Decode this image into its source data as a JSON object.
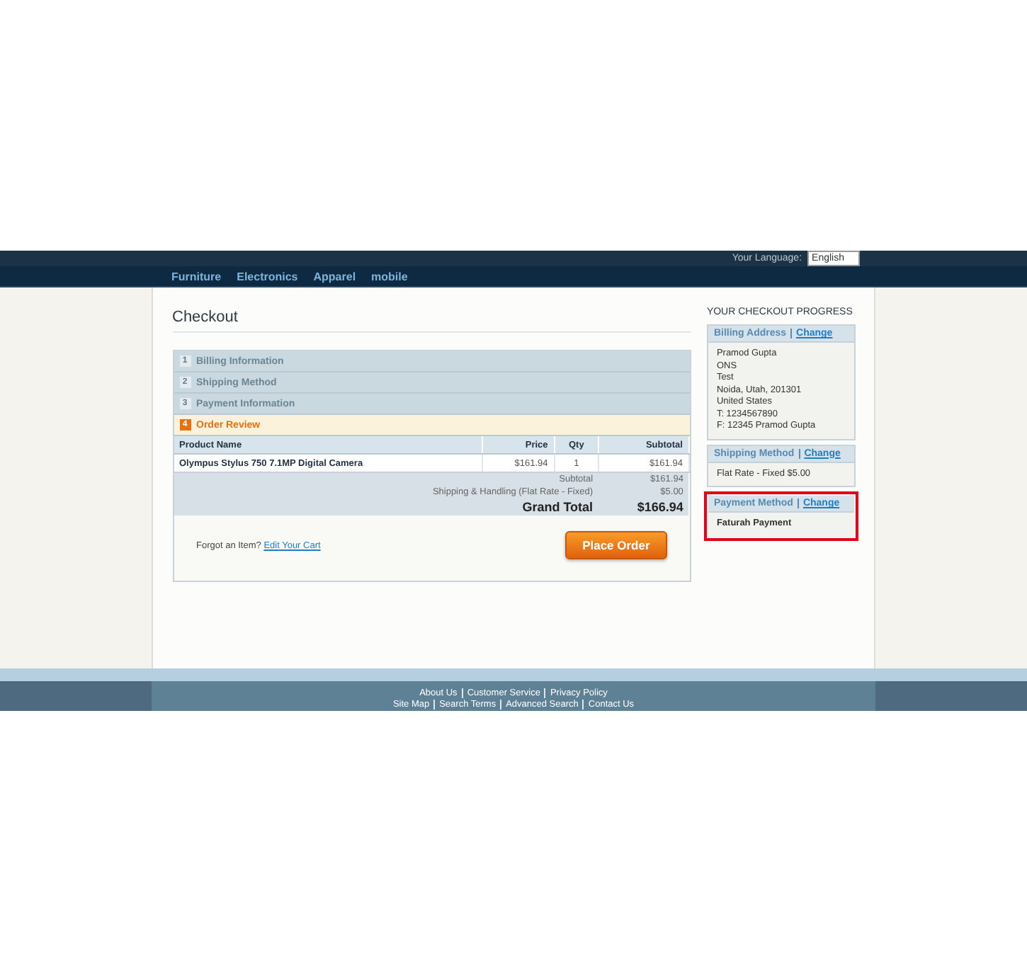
{
  "header": {
    "language_label": "Your Language:",
    "language_value": "English"
  },
  "nav": [
    "Furniture",
    "Electronics",
    "Apparel",
    "mobile"
  ],
  "page_title": "Checkout",
  "steps": [
    {
      "number": "1",
      "label": "Billing Information",
      "selected": false
    },
    {
      "number": "2",
      "label": "Shipping Method",
      "selected": false
    },
    {
      "number": "3",
      "label": "Payment Information",
      "selected": false
    },
    {
      "number": "4",
      "label": "Order Review",
      "selected": true
    }
  ],
  "table": {
    "columns": [
      "Product Name",
      "Price",
      "Qty",
      "Subtotal"
    ],
    "rows": [
      [
        "Olympus Stylus 750 7.1MP Digital Camera",
        "$161.94",
        "1",
        "$161.94"
      ]
    ],
    "totals": [
      {
        "label": "Subtotal",
        "value": "$161.94",
        "kind": "normal"
      },
      {
        "label": "Shipping & Handling (Flat Rate - Fixed)",
        "value": "$5.00",
        "kind": "normal"
      },
      {
        "label": "Grand Total",
        "value": "$166.94",
        "kind": "grand"
      }
    ]
  },
  "review_footer": {
    "prompt": "Forgot an Item?",
    "link": "Edit Your Cart",
    "button": "Place Order"
  },
  "progress": {
    "title": "YOUR CHECKOUT PROGRESS",
    "sections": [
      {
        "title": "Billing Address",
        "link": "Change",
        "highlighted": false,
        "lines": [
          "Pramod Gupta",
          "ONS",
          "Test",
          "Noida, Utah, 201301",
          "United States",
          "T: 1234567890",
          "F: 12345 Pramod Gupta"
        ],
        "bold": false
      },
      {
        "title": "Shipping Method",
        "link": "Change",
        "highlighted": false,
        "lines": [
          "Flat Rate - Fixed $5.00"
        ],
        "bold": false
      },
      {
        "title": "Payment Method",
        "link": "Change",
        "highlighted": true,
        "lines": [
          "Faturah Payment"
        ],
        "bold": true
      }
    ]
  },
  "footer": {
    "rows": [
      [
        "About Us",
        "Customer Service",
        "Privacy Policy"
      ],
      [
        "Site Map",
        "Search Terms",
        "Advanced Search",
        "Contact Us"
      ]
    ]
  }
}
